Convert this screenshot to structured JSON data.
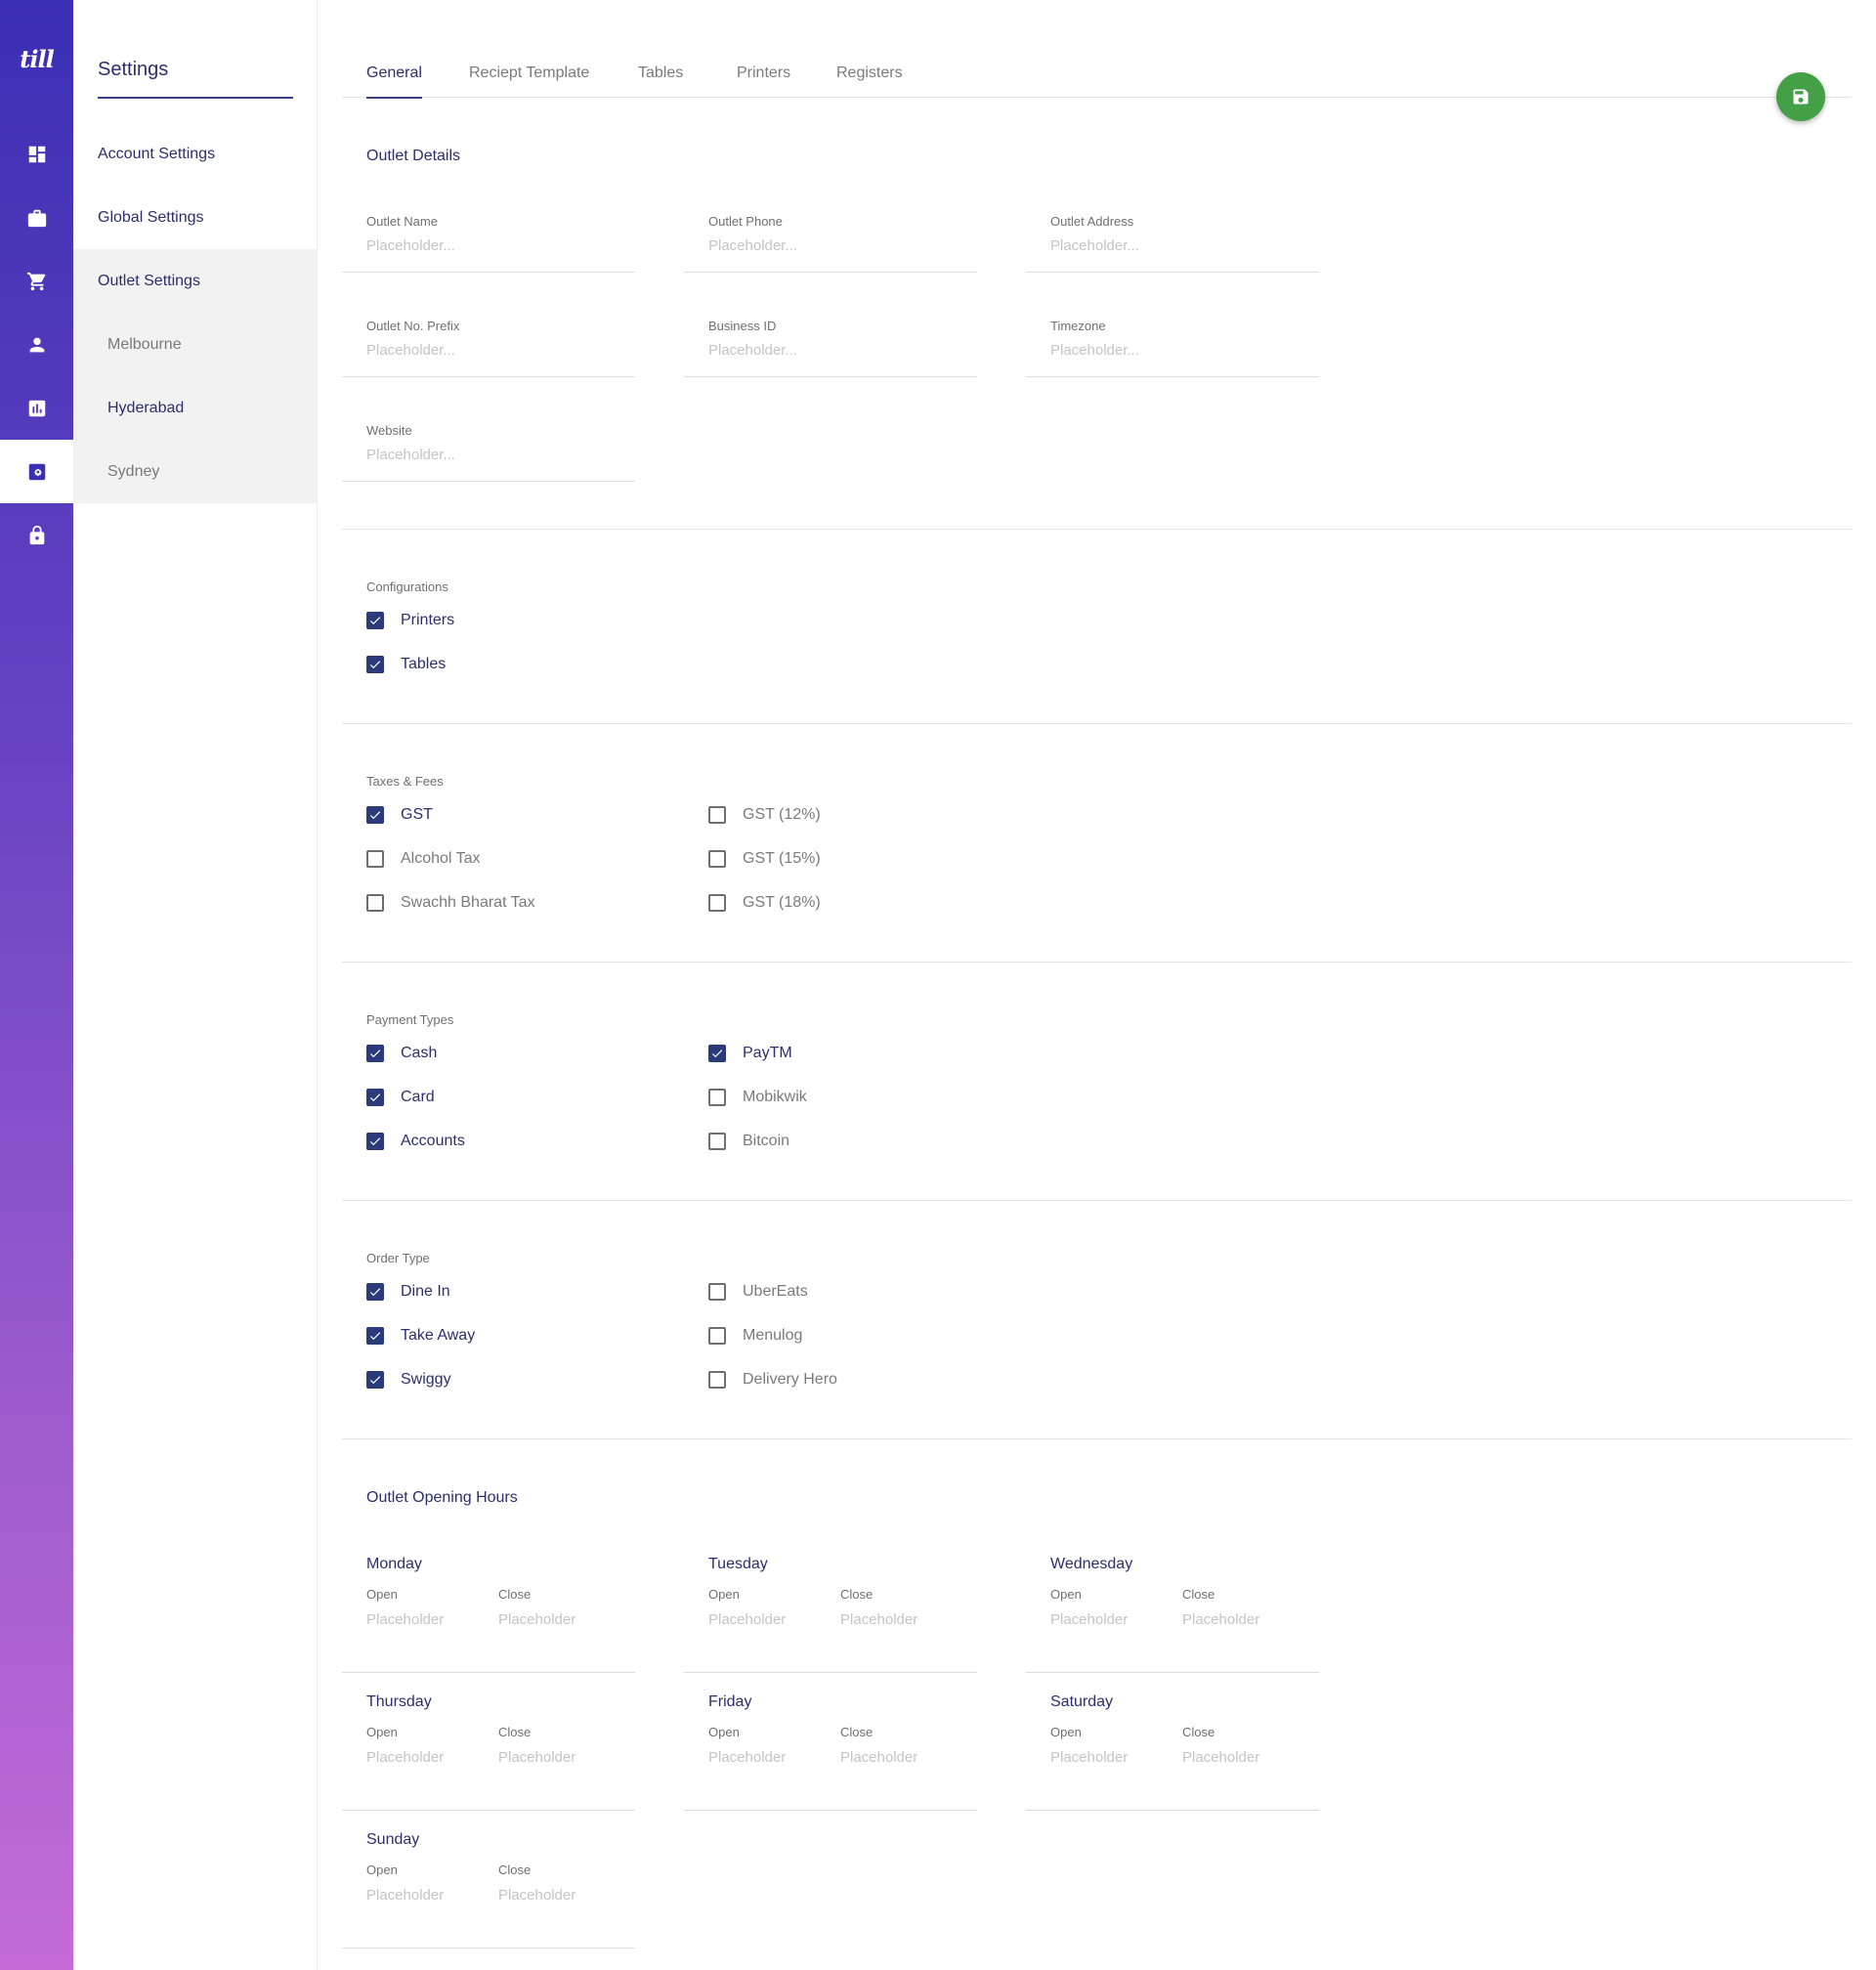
{
  "app": {
    "logo": "till"
  },
  "rail": {
    "items": [
      {
        "icon": "dashboard-icon"
      },
      {
        "icon": "briefcase-icon"
      },
      {
        "icon": "cart-icon"
      },
      {
        "icon": "user-icon"
      },
      {
        "icon": "reports-icon"
      },
      {
        "icon": "settings-icon",
        "active": true
      },
      {
        "icon": "lock-icon"
      }
    ]
  },
  "sidebar": {
    "title": "Settings",
    "items": [
      "Account Settings",
      "Global Settings",
      "Outlet Settings"
    ],
    "outlets": [
      "Melbourne",
      "Hyderabad",
      "Sydney"
    ],
    "selected_outlet": "Hyderabad"
  },
  "tabs": [
    "General",
    "Reciept Template",
    "Tables",
    "Printers",
    "Registers"
  ],
  "active_tab": "General",
  "save_button": {
    "icon": "save-icon",
    "color": "#43a047"
  },
  "outlet_details": {
    "title": "Outlet Details",
    "fields": [
      {
        "label": "Outlet Name",
        "placeholder": "Placeholder...",
        "value": ""
      },
      {
        "label": "Outlet Phone",
        "placeholder": "Placeholder...",
        "value": ""
      },
      {
        "label": "Outlet Address",
        "placeholder": "Placeholder...",
        "value": ""
      },
      {
        "label": "Outlet No. Prefix",
        "placeholder": "Placeholder...",
        "value": ""
      },
      {
        "label": "Business ID",
        "placeholder": "Placeholder...",
        "value": ""
      },
      {
        "label": "Timezone",
        "placeholder": "Placeholder...",
        "value": ""
      },
      {
        "label": "Website",
        "placeholder": "Placeholder...",
        "value": ""
      }
    ]
  },
  "configurations": {
    "label": "Configurations",
    "options": [
      {
        "label": "Printers",
        "checked": true
      },
      {
        "label": "Tables",
        "checked": true
      }
    ]
  },
  "taxes": {
    "label": "Taxes & Fees",
    "options": [
      {
        "label": "GST",
        "checked": true
      },
      {
        "label": "Alcohol Tax",
        "checked": false
      },
      {
        "label": "Swachh Bharat Tax",
        "checked": false
      },
      {
        "label": "GST (12%)",
        "checked": false
      },
      {
        "label": "GST (15%)",
        "checked": false
      },
      {
        "label": "GST (18%)",
        "checked": false
      }
    ]
  },
  "payment_types": {
    "label": "Payment Types",
    "options": [
      {
        "label": "Cash",
        "checked": true
      },
      {
        "label": "Card",
        "checked": true
      },
      {
        "label": "Accounts",
        "checked": true
      },
      {
        "label": "PayTM",
        "checked": true
      },
      {
        "label": "Mobikwik",
        "checked": false
      },
      {
        "label": "Bitcoin",
        "checked": false
      }
    ]
  },
  "order_type": {
    "label": "Order Type",
    "options": [
      {
        "label": "Dine In",
        "checked": true
      },
      {
        "label": "Take Away",
        "checked": true
      },
      {
        "label": "Swiggy",
        "checked": true
      },
      {
        "label": "UberEats",
        "checked": false
      },
      {
        "label": "Menulog",
        "checked": false
      },
      {
        "label": "Delivery Hero",
        "checked": false
      }
    ]
  },
  "opening_hours": {
    "title": "Outlet Opening Hours",
    "open_label": "Open",
    "close_label": "Close",
    "placeholder": "Placeholder",
    "days": [
      "Monday",
      "Tuesday",
      "Wednesday",
      "Thursday",
      "Friday",
      "Saturday",
      "Sunday"
    ]
  },
  "colors": {
    "accent": "#2b3a7a",
    "rail_gradient_top": "#3b2fb4",
    "rail_gradient_bottom": "#c46bd8",
    "save_green": "#43a047"
  }
}
